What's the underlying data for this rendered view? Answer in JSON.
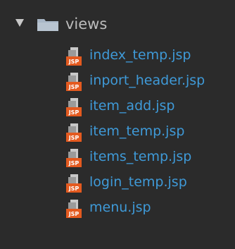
{
  "folder": {
    "name": "views",
    "expanded": true,
    "icon": "folder-icon"
  },
  "files": [
    {
      "name": "index_temp.jsp",
      "icon": "jsp-file-icon"
    },
    {
      "name": "inport_header.jsp",
      "icon": "jsp-file-icon"
    },
    {
      "name": "item_add.jsp",
      "icon": "jsp-file-icon"
    },
    {
      "name": "item_temp.jsp",
      "icon": "jsp-file-icon"
    },
    {
      "name": "items_temp.jsp",
      "icon": "jsp-file-icon"
    },
    {
      "name": "login_temp.jsp",
      "icon": "jsp-file-icon"
    },
    {
      "name": "menu.jsp",
      "icon": "jsp-file-icon"
    }
  ],
  "colors": {
    "background": "#2b2b2b",
    "folder_text": "#bcbcbc",
    "file_text": "#3f9ad8",
    "jsp_icon_orange": "#e45a1f",
    "folder_icon": "#a9b7c6"
  }
}
